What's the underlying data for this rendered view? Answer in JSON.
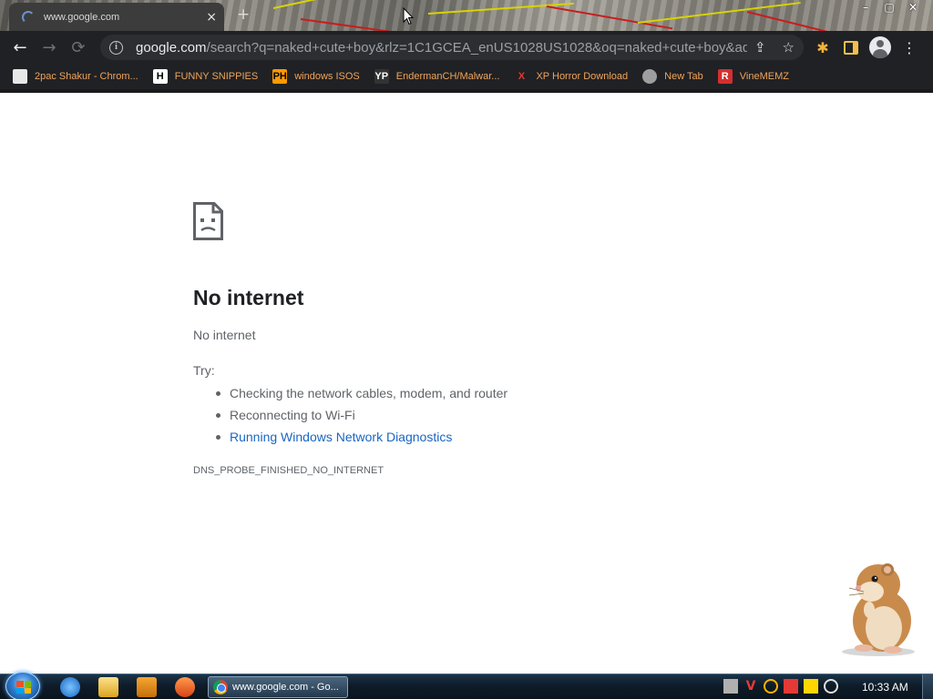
{
  "browser": {
    "tab": {
      "title": "www.google.com",
      "close_glyph": "×"
    },
    "new_tab_glyph": "+",
    "window_controls": {
      "minimize": "–",
      "maximize": "▢",
      "close": "✕"
    },
    "nav": {
      "back": "←",
      "forward": "→",
      "reload": "⟳"
    },
    "address_bar": {
      "host": "google.com",
      "path": "/search?q=naked+cute+boy&rlz=1C1GCEA_enUS1028US1028&oq=naked+cute+boy&aqs=chr..."
    },
    "icons": {
      "info": "info-icon",
      "share": "share-icon",
      "bookmark_star": "star-icon",
      "extensions": "puzzle-icon",
      "side_panel": "side-panel-icon",
      "profile": "profile-icon",
      "menu": "menu-icon"
    },
    "bookmarks": [
      {
        "label": "2pac Shakur - Chrom...",
        "icon": "gift-icon",
        "icon_text": "",
        "icon_bg": "#e8e8e8",
        "icon_fg": "#c62828"
      },
      {
        "label": "FUNNY SNIPPIES",
        "icon": "h-icon",
        "icon_text": "H",
        "icon_bg": "#ffffff",
        "icon_fg": "#000000"
      },
      {
        "label": "windows ISOS",
        "icon": "ph-icon",
        "icon_text": "PH",
        "icon_bg": "#ff9900",
        "icon_fg": "#000000"
      },
      {
        "label": "EndermanCH/Malwar...",
        "icon": "yp-icon",
        "icon_text": "YP",
        "icon_bg": "#333333",
        "icon_fg": "#ffffff"
      },
      {
        "label": "XP Horror Download",
        "icon": "x-icon",
        "icon_text": "X",
        "icon_bg": "transparent",
        "icon_fg": "#e53935"
      },
      {
        "label": "New Tab",
        "icon": "globe-icon",
        "icon_text": "",
        "icon_bg": "#9e9e9e",
        "icon_fg": "#ffffff"
      },
      {
        "label": "VineMEMZ",
        "icon": "r-icon",
        "icon_text": "R",
        "icon_bg": "#d32f2f",
        "icon_fg": "#ffffff"
      }
    ]
  },
  "error": {
    "title": "No internet",
    "subtitle": "No internet",
    "try_label": "Try:",
    "suggestions": [
      {
        "text": "Checking the network cables, modem, and router",
        "link": false
      },
      {
        "text": "Reconnecting to Wi-Fi",
        "link": false
      },
      {
        "text": "Running Windows Network Diagnostics",
        "link": true
      }
    ],
    "code": "DNS_PROBE_FINISHED_NO_INTERNET"
  },
  "taskbar": {
    "task_button_label": "www.google.com - Go...",
    "clock": "10:33 AM"
  },
  "colors": {
    "link": "#1a66c2",
    "error_text": "#5f6368",
    "chrome_dark": "#202124",
    "bookmark_text": "#f0a45b"
  }
}
